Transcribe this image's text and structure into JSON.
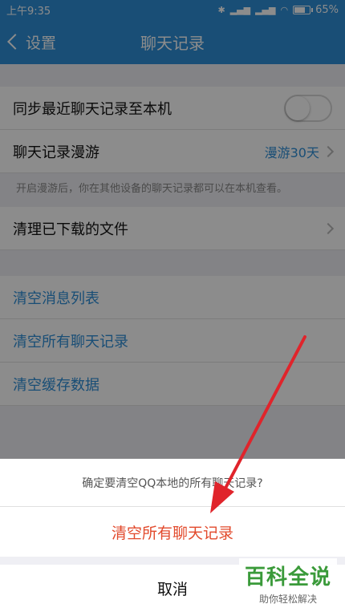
{
  "status_bar": {
    "time": "上午9:35",
    "battery": "65%",
    "battery_level": 0.65
  },
  "nav": {
    "back_label": "设置",
    "title": "聊天记录"
  },
  "settings": {
    "sync_label": "同步最近聊天记录至本机",
    "sync_enabled": false,
    "roaming_label": "聊天记录漫游",
    "roaming_value": "漫游30天",
    "roaming_note": "开启漫游后，你在其他设备的聊天记录都可以在本机查看。",
    "clear_downloads_label": "清理已下载的文件",
    "clear_message_list": "清空消息列表",
    "clear_all_chats": "清空所有聊天记录",
    "clear_cache": "清空缓存数据"
  },
  "action_sheet": {
    "prompt": "确定要清空QQ本地的所有聊天记录?",
    "confirm_label": "清空所有聊天记录",
    "cancel_label": "取消"
  },
  "watermark": {
    "main": "百科全说",
    "sub": "助你轻松解决"
  },
  "colors": {
    "accent": "#2f8fd8",
    "danger": "#e24a2c",
    "annotation": "#e0242b"
  }
}
